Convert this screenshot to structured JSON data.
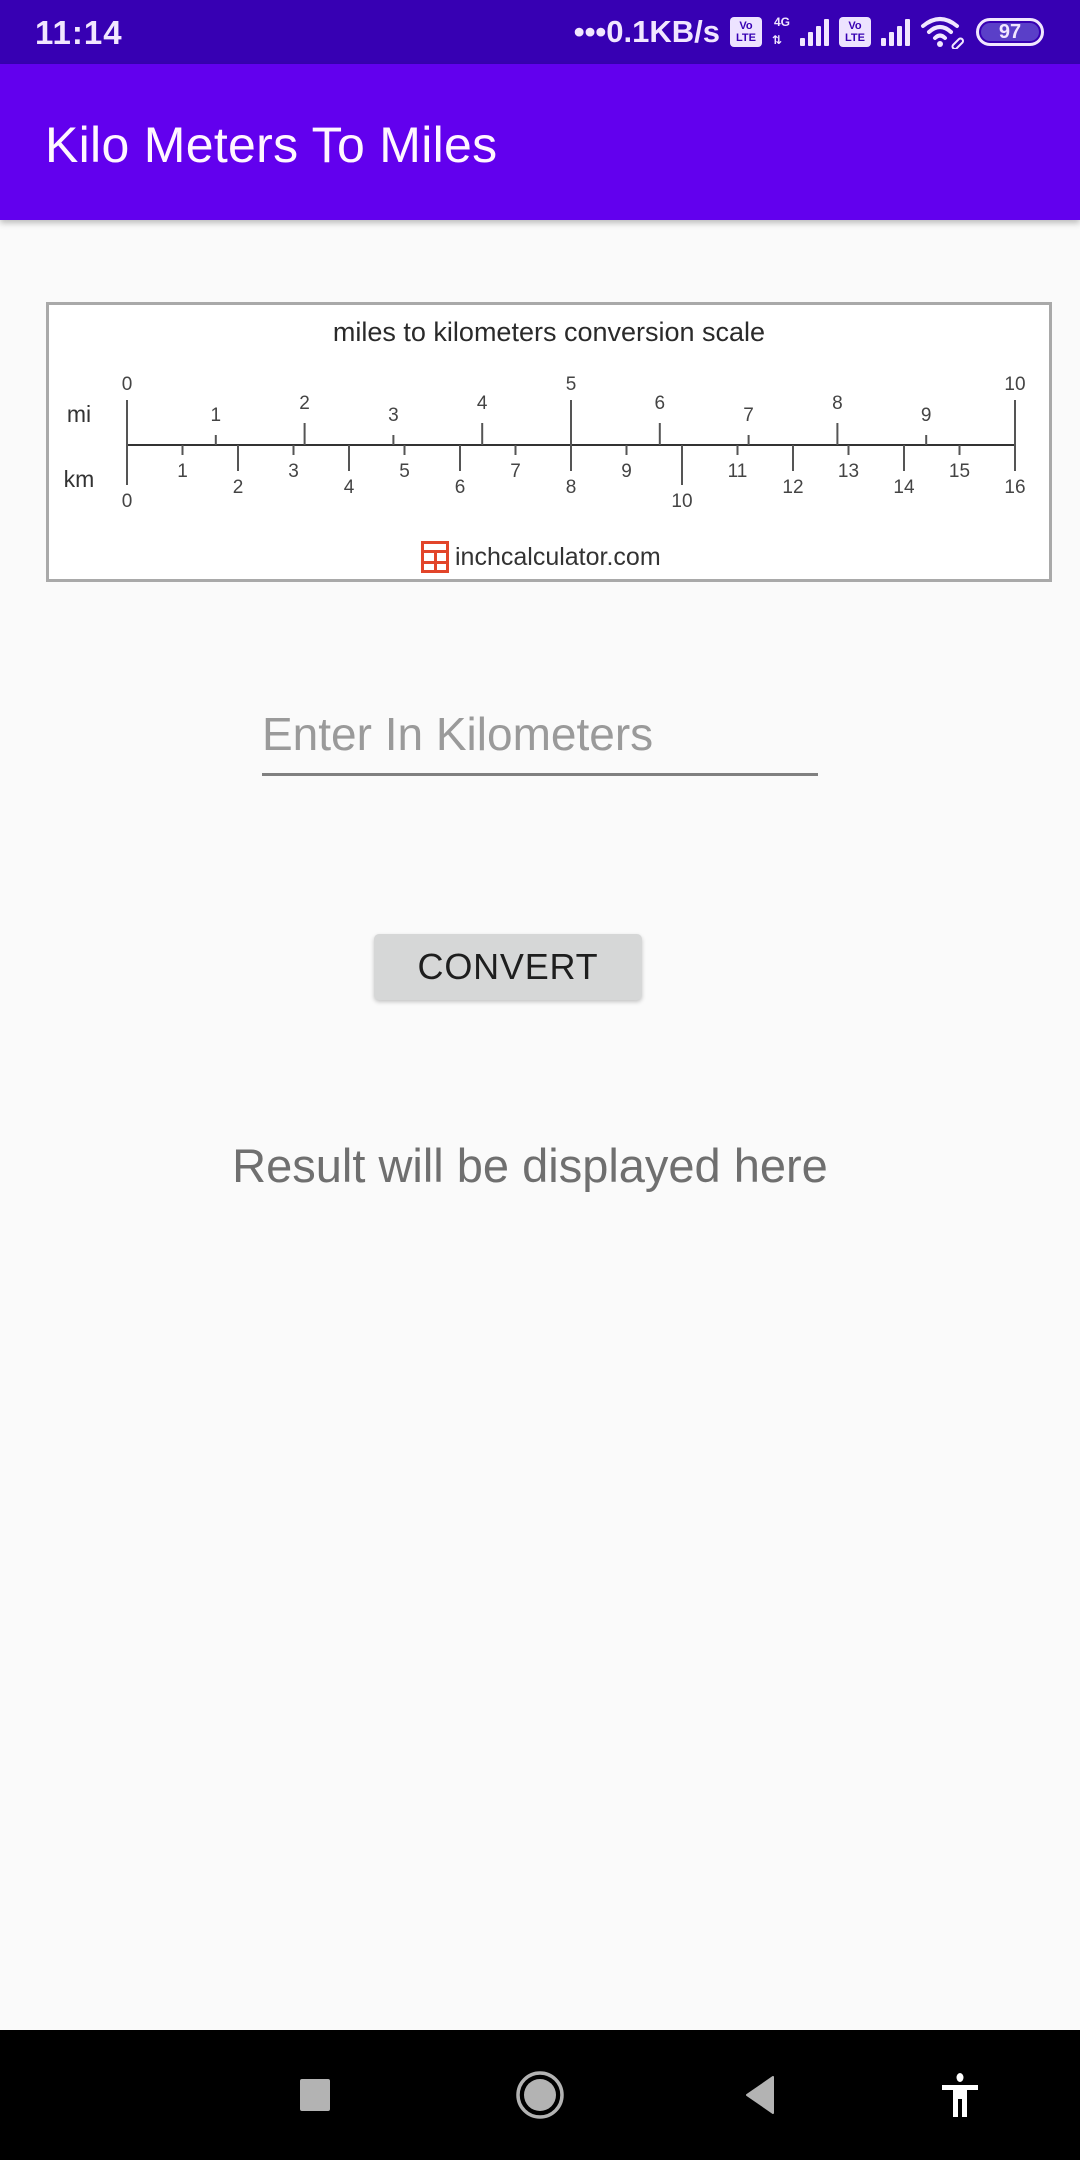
{
  "status_bar": {
    "time": "11:14",
    "network_speed": "•••0.1KB/s",
    "sim1_badge": "Vo LTE",
    "sim1_network_type": "4G",
    "sim2_badge": "Vo LTE",
    "battery_level": "97",
    "icons": [
      "volte-icon",
      "signal-4g-icon",
      "volte-icon",
      "signal-icon",
      "wifi-icon",
      "battery-icon"
    ]
  },
  "app_bar": {
    "title": "Kilo Meters To Miles",
    "color": "#6200EE",
    "status_color": "#3700B3"
  },
  "scale_image": {
    "title": "miles to kilometers conversion scale",
    "mi_label": "mi",
    "km_label": "km",
    "mi_ticks": [
      "0",
      "1",
      "2",
      "3",
      "4",
      "5",
      "6",
      "7",
      "8",
      "9",
      "10"
    ],
    "km_ticks": [
      "0",
      "1",
      "2",
      "3",
      "4",
      "5",
      "6",
      "7",
      "8",
      "9",
      "10",
      "11",
      "12",
      "13",
      "14",
      "15",
      "16"
    ],
    "mi_max": 10,
    "km_max": 16,
    "footer_text": "inchcalculator.com",
    "footer_icon": "calculator-icon",
    "footer_color": "#E2452A"
  },
  "form": {
    "km_input_value": "",
    "km_input_placeholder": "Enter In Kilometers",
    "convert_label": "CONVERT"
  },
  "result": {
    "text": "Result will be displayed here"
  },
  "nav_bar": {
    "buttons": [
      "recents-icon",
      "home-icon",
      "back-icon",
      "accessibility-icon"
    ]
  }
}
